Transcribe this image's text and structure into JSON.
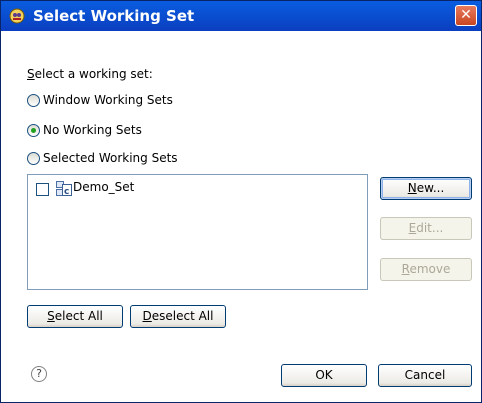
{
  "window": {
    "title": "Select Working Set",
    "close_glyph": "✕"
  },
  "section_label": "Select a working set:",
  "radios": [
    {
      "label": "Window Working Sets",
      "checked": false
    },
    {
      "label": "No Working Sets",
      "checked": true
    },
    {
      "label": "Selected Working Sets",
      "checked": false
    }
  ],
  "list": {
    "items": [
      {
        "label": "Demo_Set",
        "checked": false,
        "icon": "working-set-icon"
      }
    ]
  },
  "side_buttons": {
    "new": "New...",
    "edit": "Edit...",
    "remove": "Remove"
  },
  "bottom_buttons": {
    "select_all": "Select All",
    "deselect_all": "Deselect All"
  },
  "footer": {
    "help_glyph": "?",
    "ok": "OK",
    "cancel": "Cancel"
  },
  "colors": {
    "titlebar": "#0a4ed0",
    "close": "#c94621",
    "radio_dot": "#21a121"
  }
}
